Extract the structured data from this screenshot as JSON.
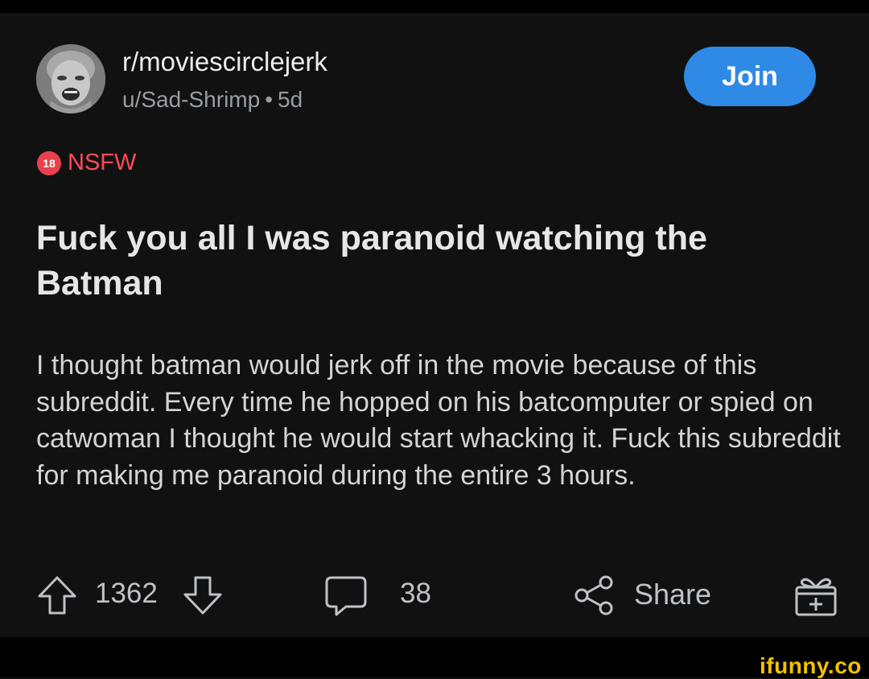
{
  "post": {
    "subreddit": "r/moviescirclejerk",
    "author": "u/Sad-Shrimp",
    "separator": "•",
    "age": "5d",
    "join_label": "Join",
    "nsfw_badge": "18",
    "nsfw_label": "NSFW",
    "title": "Fuck you all I was paranoid watching the Batman",
    "body": "I thought batman would jerk off in the movie because of this subreddit. Every time he hopped on his batcomputer or spied on catwoman I thought he would start whacking it. Fuck this subreddit for making me paranoid during the entire 3 hours."
  },
  "actions": {
    "votes": "1362",
    "comments": "38",
    "share_label": "Share"
  },
  "icons": {
    "upvote": "arrow-up-outline",
    "downvote": "arrow-down-outline",
    "comment": "speech-bubble",
    "share": "share-nodes",
    "award": "gift-box"
  },
  "colors": {
    "accent": "#2f8ae5",
    "nsfw": "#ff4b58",
    "watermark": "#f2c200"
  },
  "watermark": "ifunny.co"
}
